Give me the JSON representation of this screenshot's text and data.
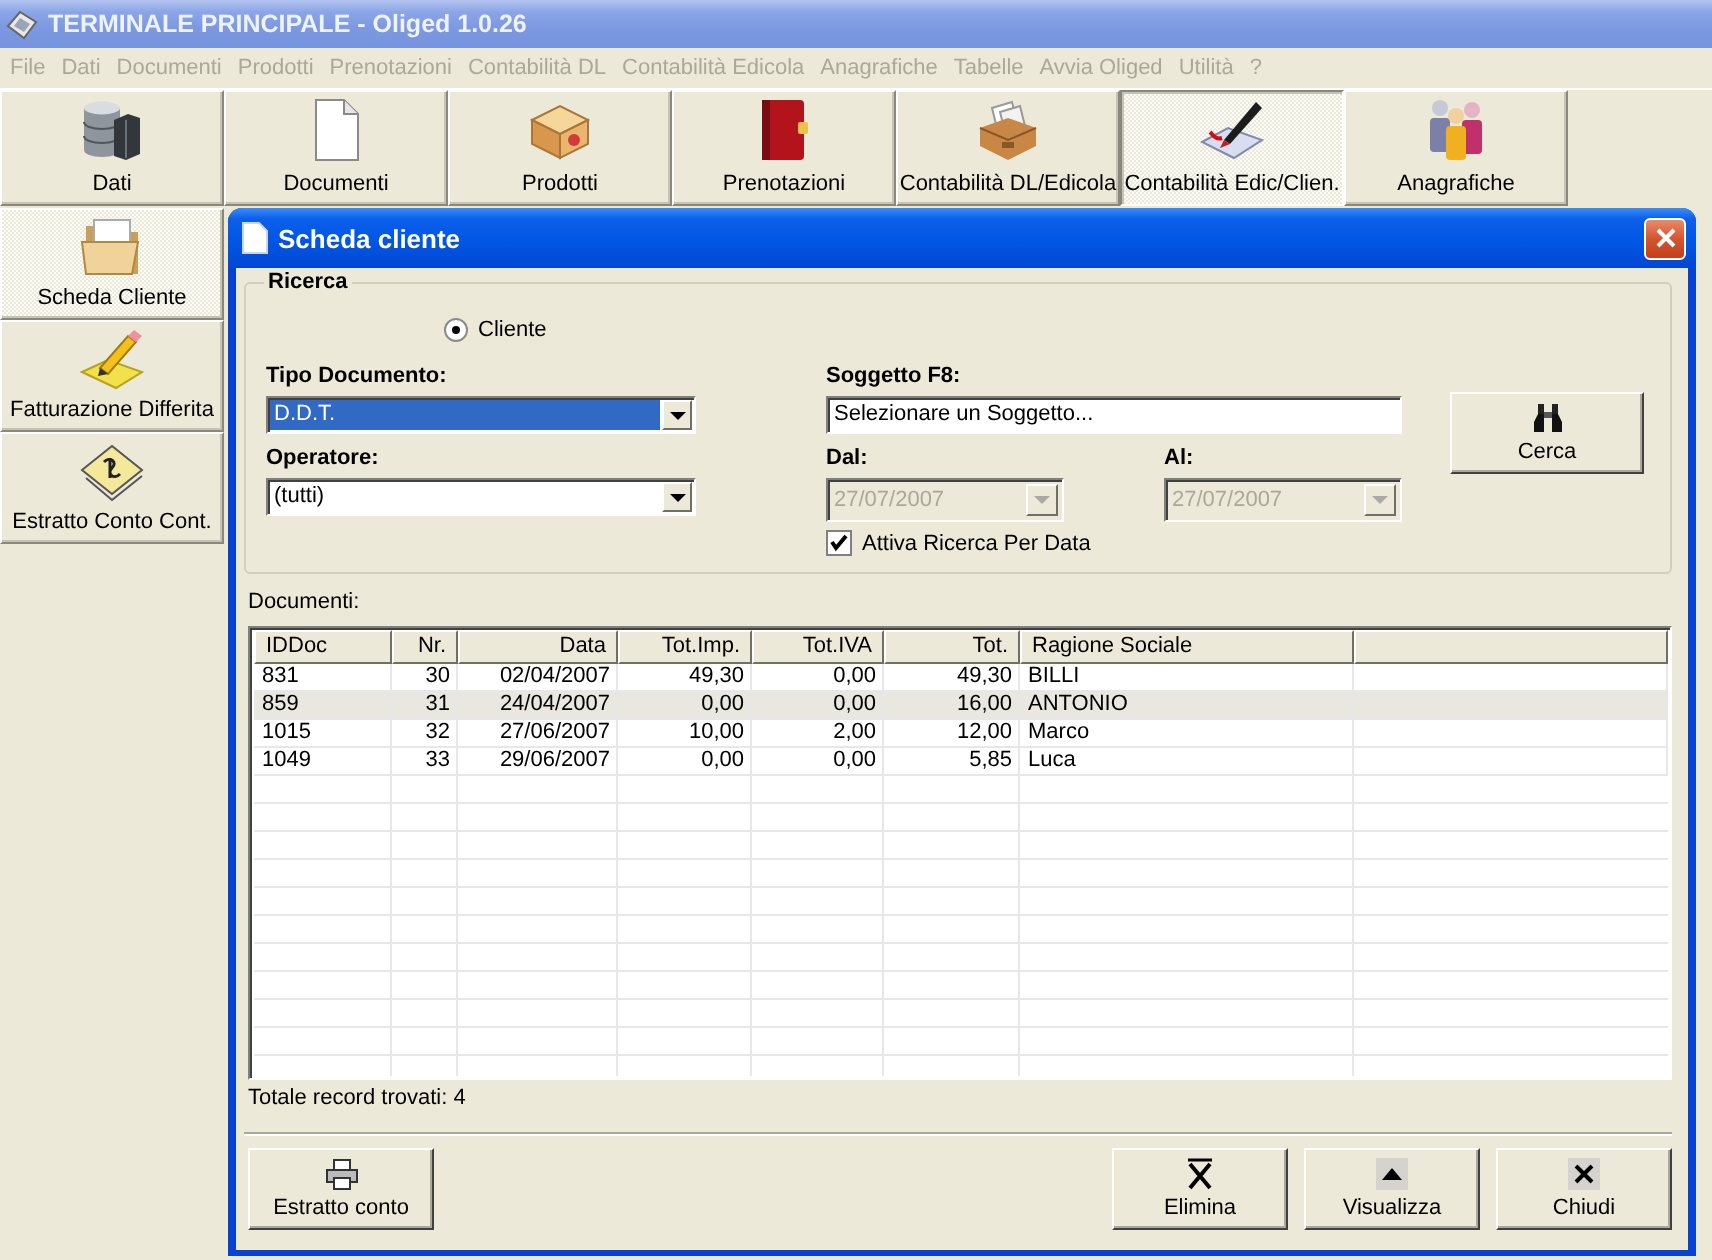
{
  "window": {
    "title": "TERMINALE PRINCIPALE - Oliged 1.0.26"
  },
  "menu": [
    {
      "label": "File",
      "disabled": true
    },
    {
      "label": "Dati",
      "disabled": true
    },
    {
      "label": "Documenti",
      "disabled": true
    },
    {
      "label": "Prodotti",
      "disabled": true
    },
    {
      "label": "Prenotazioni",
      "disabled": true
    },
    {
      "label": "Contabilità DL",
      "disabled": true
    },
    {
      "label": "Contabilità Edicola",
      "disabled": true
    },
    {
      "label": "Anagrafiche",
      "disabled": true
    },
    {
      "label": "Tabelle",
      "disabled": true
    },
    {
      "label": "Avvia Oliged",
      "disabled": true
    },
    {
      "label": "Utilità",
      "disabled": true
    },
    {
      "label": "?",
      "disabled": true
    }
  ],
  "toolbar": [
    {
      "label": "Dati",
      "kind": "database",
      "selected": false
    },
    {
      "label": "Documenti",
      "kind": "document",
      "selected": false
    },
    {
      "label": "Prodotti",
      "kind": "parcel",
      "selected": false
    },
    {
      "label": "Prenotazioni",
      "kind": "book",
      "selected": false
    },
    {
      "label": "Contabilità DL/Edicola",
      "kind": "cardfile",
      "selected": false
    },
    {
      "label": "Contabilità Edic/Clien.",
      "kind": "pen",
      "selected": true
    },
    {
      "label": "Anagrafiche",
      "kind": "people",
      "selected": false
    }
  ],
  "sidebar": [
    {
      "label": "Scheda Cliente",
      "kind": "folder",
      "selected": true
    },
    {
      "label": "Fatturazione Differita",
      "kind": "pencil",
      "selected": false
    },
    {
      "label": "Estratto Conto Cont.",
      "kind": "paper",
      "selected": false
    }
  ],
  "dialog": {
    "title": "Scheda cliente",
    "search": {
      "title": "Ricerca",
      "mode": {
        "label": "Cliente",
        "selected": true
      },
      "doc_type": {
        "label": "Tipo Documento:",
        "value": "D.D.T.",
        "focused": true
      },
      "operator": {
        "label": "Operatore:",
        "value": "(tutti)",
        "focused": false
      },
      "subject": {
        "label": "Soggetto F8:",
        "value": "Selezionare un Soggetto..."
      },
      "date_from": {
        "label": "Dal:",
        "value": "27/07/2007",
        "disabled": true
      },
      "date_to": {
        "label": "Al:",
        "value": "27/07/2007",
        "disabled": true
      },
      "date_filter": {
        "label": "Attiva Ricerca Per Data",
        "checked": true
      },
      "search_button": {
        "label": "Cerca"
      }
    },
    "documents": {
      "label": "Documenti:",
      "columns": [
        "IDDoc",
        "Nr.",
        "Data",
        "Tot.Imp.",
        "Tot.IVA",
        "Tot.",
        "Ragione Sociale"
      ],
      "rows": [
        {
          "cells": [
            "831",
            "30",
            "02/04/2007",
            "49,30",
            "0,00",
            "49,30",
            "BILLI"
          ],
          "selected": false
        },
        {
          "cells": [
            "859",
            "31",
            "24/04/2007",
            "0,00",
            "0,00",
            "16,00",
            "ANTONIO"
          ],
          "selected": true
        },
        {
          "cells": [
            "1015",
            "32",
            "27/06/2007",
            "10,00",
            "2,00",
            "12,00",
            "Marco"
          ],
          "selected": false
        },
        {
          "cells": [
            "1049",
            "33",
            "29/06/2007",
            "0,00",
            "0,00",
            "5,85",
            "Luca"
          ],
          "selected": false
        }
      ]
    },
    "total": "Totale record trovati: 4",
    "buttons": [
      {
        "label": "Estratto conto",
        "kind": "print"
      },
      {
        "label": "Elimina",
        "kind": "delete"
      },
      {
        "label": "Visualizza",
        "kind": "view"
      },
      {
        "label": "Chiudi",
        "kind": "close"
      }
    ]
  }
}
